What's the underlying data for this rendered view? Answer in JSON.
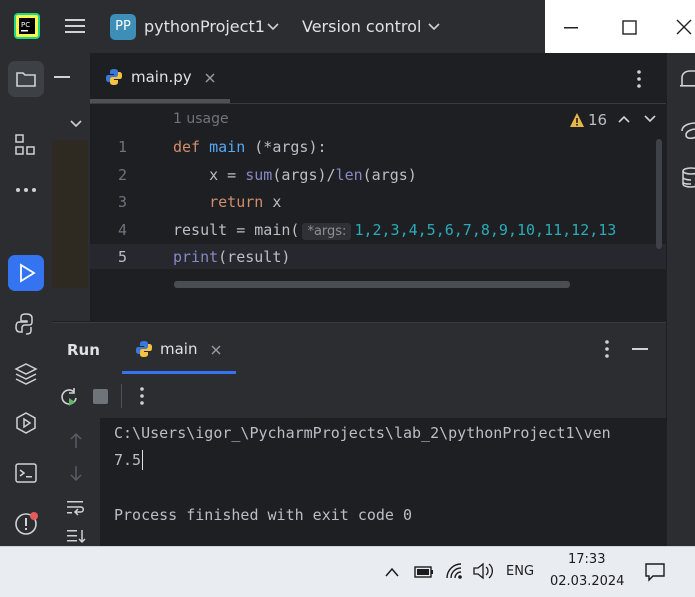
{
  "titlebar": {
    "project_badge": "PP",
    "project_name": "pythonProject1",
    "vcs_label": "Version control"
  },
  "editor": {
    "tab_label": "main.py",
    "usage_hint": "1 usage",
    "warning_count": "16",
    "lines": [
      {
        "num": "1"
      },
      {
        "num": "2"
      },
      {
        "num": "3"
      },
      {
        "num": "4"
      },
      {
        "num": "5"
      }
    ],
    "code": {
      "l1_def": "def ",
      "l1_fn": "main",
      "l1_rest": " (*args):",
      "l2_indent": "    x = ",
      "l2_sum": "sum",
      "l2_mid": "(args)/",
      "l2_len": "len",
      "l2_end": "(args)",
      "l3_indent": "    ",
      "l3_return": "return",
      "l3_rest": " x",
      "l4_start": "result = main(",
      "l4_hint": "*args:",
      "l4_args": "1,2,3,4,5,6,7,8,9,10,11,12,13",
      "l5_print": "print",
      "l5_rest": "(result)"
    }
  },
  "run": {
    "tab_title": "Run",
    "config_name": "main",
    "output_lines": [
      "C:\\Users\\igor_\\PycharmProjects\\lab_2\\pythonProject1\\ven",
      "7.5",
      "",
      "Process finished with exit code 0"
    ]
  },
  "taskbar": {
    "language": "ENG",
    "time": "17:33",
    "date": "02.03.2024"
  }
}
